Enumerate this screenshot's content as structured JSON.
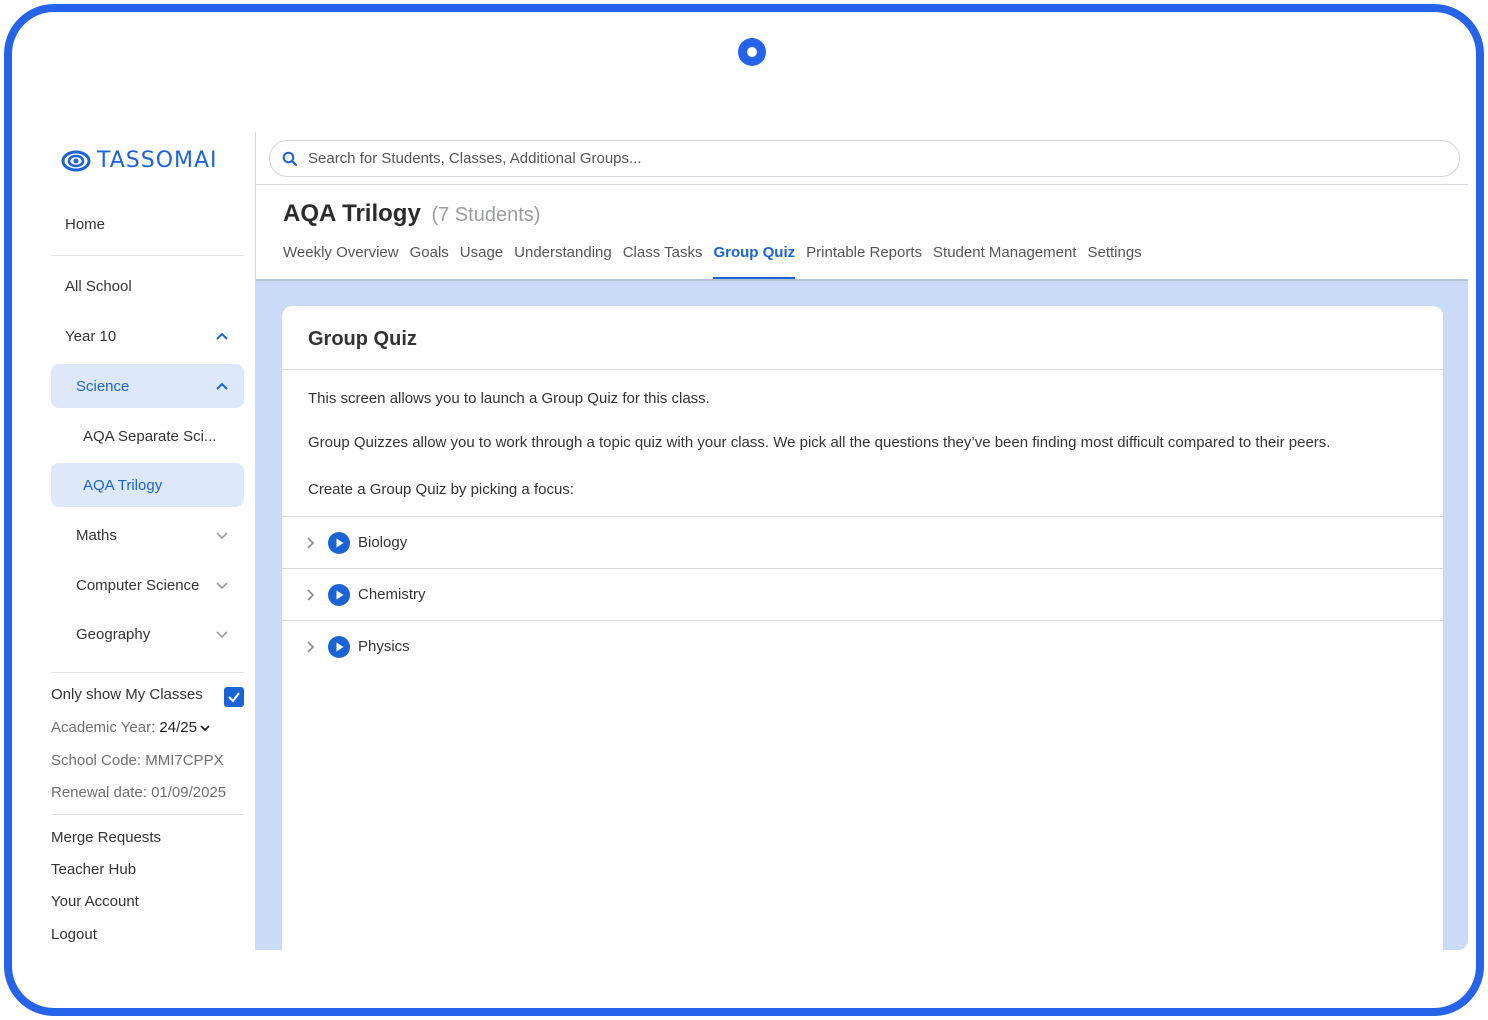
{
  "brand": {
    "name": "TASSOMAI",
    "color": "#1b64d8"
  },
  "sidebar": {
    "home": "Home",
    "all_school": "All School",
    "items": [
      {
        "label": "Year 10",
        "icon": "chevron-up-icon",
        "active": false
      },
      {
        "label": "Science",
        "icon": "chevron-up-icon",
        "active": true
      },
      {
        "label": "AQA Separate Sci...",
        "icon": "",
        "active": false
      },
      {
        "label": "AQA Trilogy",
        "icon": "",
        "active": true
      },
      {
        "label": "Maths",
        "icon": "chevron-down-icon",
        "active": false
      },
      {
        "label": "Computer Science",
        "icon": "chevron-down-icon",
        "active": false
      },
      {
        "label": "Geography",
        "icon": "chevron-down-icon",
        "active": false
      }
    ],
    "only_my_classes": {
      "label": "Only show My Classes",
      "checked": true
    },
    "academic_year": {
      "label": "Academic Year:",
      "value": "24/25"
    },
    "school_code": "School Code: MMI7CPPX",
    "renewal_date": "Renewal date: 01/09/2025",
    "links": [
      "Merge Requests",
      "Teacher Hub",
      "Your Account",
      "Logout"
    ]
  },
  "search": {
    "placeholder": "Search for Students, Classes, Additional Groups..."
  },
  "header": {
    "title": "AQA Trilogy",
    "student_count": "(7 Students)",
    "tabs": [
      {
        "label": "Weekly Overview",
        "active": false
      },
      {
        "label": "Goals",
        "active": false
      },
      {
        "label": "Usage",
        "active": false
      },
      {
        "label": "Understanding",
        "active": false
      },
      {
        "label": "Class Tasks",
        "active": false
      },
      {
        "label": "Group Quiz",
        "active": true
      },
      {
        "label": "Printable Reports",
        "active": false
      },
      {
        "label": "Student Management",
        "active": false
      },
      {
        "label": "Settings",
        "active": false
      }
    ]
  },
  "card": {
    "title": "Group Quiz",
    "intro": "This screen allows you to launch a Group Quiz for this class.",
    "description": "Group Quizzes allow you to work through a topic quiz with your class. We pick all the questions they’ve been finding most difficult compared to their peers.",
    "prompt": "Create a Group Quiz by picking a focus:",
    "topics": [
      "Biology",
      "Chemistry",
      "Physics"
    ]
  },
  "colors": {
    "accent": "#1b64d8",
    "frame": "#2563eb",
    "content_bg": "#c9dbf7",
    "active_nav_bg": "#dde8fb"
  }
}
